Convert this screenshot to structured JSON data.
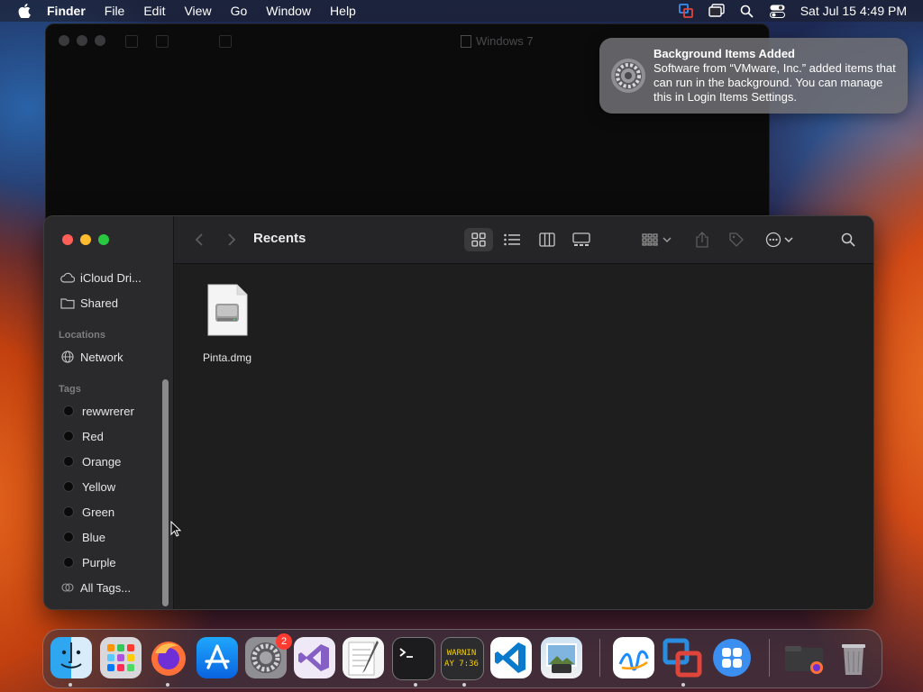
{
  "menubar": {
    "app_name": "Finder",
    "items": [
      "File",
      "Edit",
      "View",
      "Go",
      "Window",
      "Help"
    ],
    "clock": "Sat Jul 15  4:49 PM"
  },
  "vm_window": {
    "title": "Windows 7"
  },
  "notification": {
    "title": "Background Items Added",
    "body": "Software from “VMware, Inc.” added items that can run in the background. You can manage this in Login Items Settings."
  },
  "finder": {
    "title": "Recents",
    "sidebar": {
      "top_items": [
        {
          "label": "iCloud Dri...",
          "icon": "cloud-icon"
        },
        {
          "label": "Shared",
          "icon": "shared-folder-icon"
        }
      ],
      "locations_heading": "Locations",
      "locations": [
        {
          "label": "Network",
          "icon": "globe-icon"
        }
      ],
      "tags_heading": "Tags",
      "tags": [
        "rewwrerer",
        "Red",
        "Orange",
        "Yellow",
        "Green",
        "Blue",
        "Purple"
      ],
      "all_tags": "All Tags..."
    },
    "files": [
      {
        "name": "Pinta.dmg",
        "icon": "disk-image-icon"
      }
    ]
  },
  "colors": {
    "close": "#ff5f57",
    "minimize": "#febc2e",
    "zoom": "#28c840",
    "badge": "#ff3b30"
  },
  "dock": {
    "settings_badge": "2",
    "console_text": [
      "WARNIN",
      "AY 7:36"
    ]
  }
}
